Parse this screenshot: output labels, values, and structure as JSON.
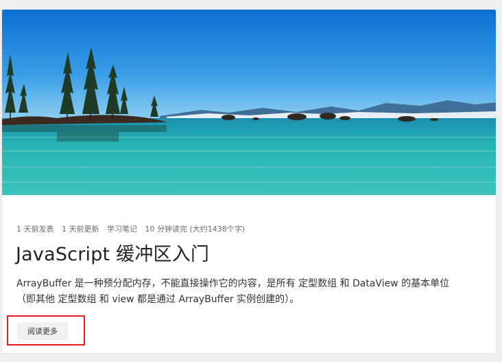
{
  "post": {
    "meta": [
      "1 天前发表",
      "1 天前更新",
      "学习笔记",
      "10 分钟读完 (大约1438个字)"
    ],
    "title": "JavaScript 缓冲区入门",
    "excerpt_line1": "ArrayBuffer 是一种预分配内存，不能直接操作它的内容，是所有 定型数组 和 DataView 的基本单位",
    "excerpt_line2": "（即其他 定型数组 和 view 都是通过 ArrayBuffer 实例创建的）。",
    "read_more_label": "阅读更多"
  },
  "colors": {
    "highlight": "#e02020",
    "sky": "#1a7fd6",
    "water": "#2fb8b0"
  }
}
